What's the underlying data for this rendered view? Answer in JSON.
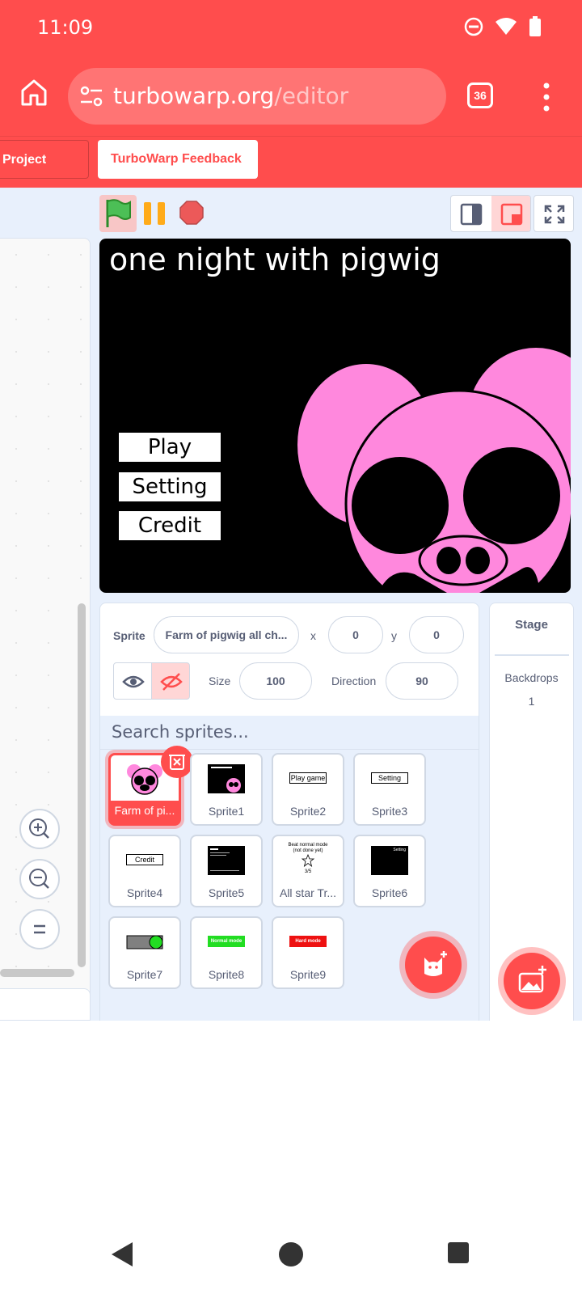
{
  "status_bar": {
    "time": "11:09"
  },
  "browser": {
    "url_host": "turbowarp.org",
    "url_path": "/editor",
    "tab_count": "36"
  },
  "menu": {
    "project_page": "Project Page",
    "feedback": "TurboWarp Feedback"
  },
  "stage": {
    "title": "one night with pigwig",
    "buttons": [
      "Play game",
      "Setting",
      "Credit"
    ]
  },
  "sprite_info": {
    "sprite_label": "Sprite",
    "sprite_name": "Farm of pigwig all ch...",
    "x_label": "x",
    "x_value": "0",
    "y_label": "y",
    "y_value": "0",
    "size_label": "Size",
    "size_value": "100",
    "direction_label": "Direction",
    "direction_value": "90"
  },
  "search": {
    "placeholder": "Search sprites..."
  },
  "sprites": [
    {
      "label": "Farm of pi..."
    },
    {
      "label": "Sprite1"
    },
    {
      "label": "Sprite2"
    },
    {
      "label": "Sprite3"
    },
    {
      "label": "Sprite4"
    },
    {
      "label": "Sprite5"
    },
    {
      "label": "All star Tr..."
    },
    {
      "label": "Sprite6"
    },
    {
      "label": "Sprite7"
    },
    {
      "label": "Sprite8"
    },
    {
      "label": "Sprite9"
    }
  ],
  "thumbnails": {
    "sprite2_text": "Play game",
    "sprite3_text": "Setting",
    "sprite4_text": "Credit",
    "sprite6_text": "Setting",
    "sprite8_text": "Normal mode",
    "sprite9_text": "Hard mode",
    "allstar_line1": "Beat normal mode",
    "allstar_line2": "(not done yet)",
    "allstar_line3": "3/5"
  },
  "stage_panel": {
    "title": "Stage",
    "backdrops_label": "Backdrops",
    "backdrops_count": "1"
  },
  "colors": {
    "accent": "#ff4d4d",
    "panel_bg": "#e8f0fc",
    "text": "#575e75",
    "pig_pink": "#ff88dd"
  }
}
